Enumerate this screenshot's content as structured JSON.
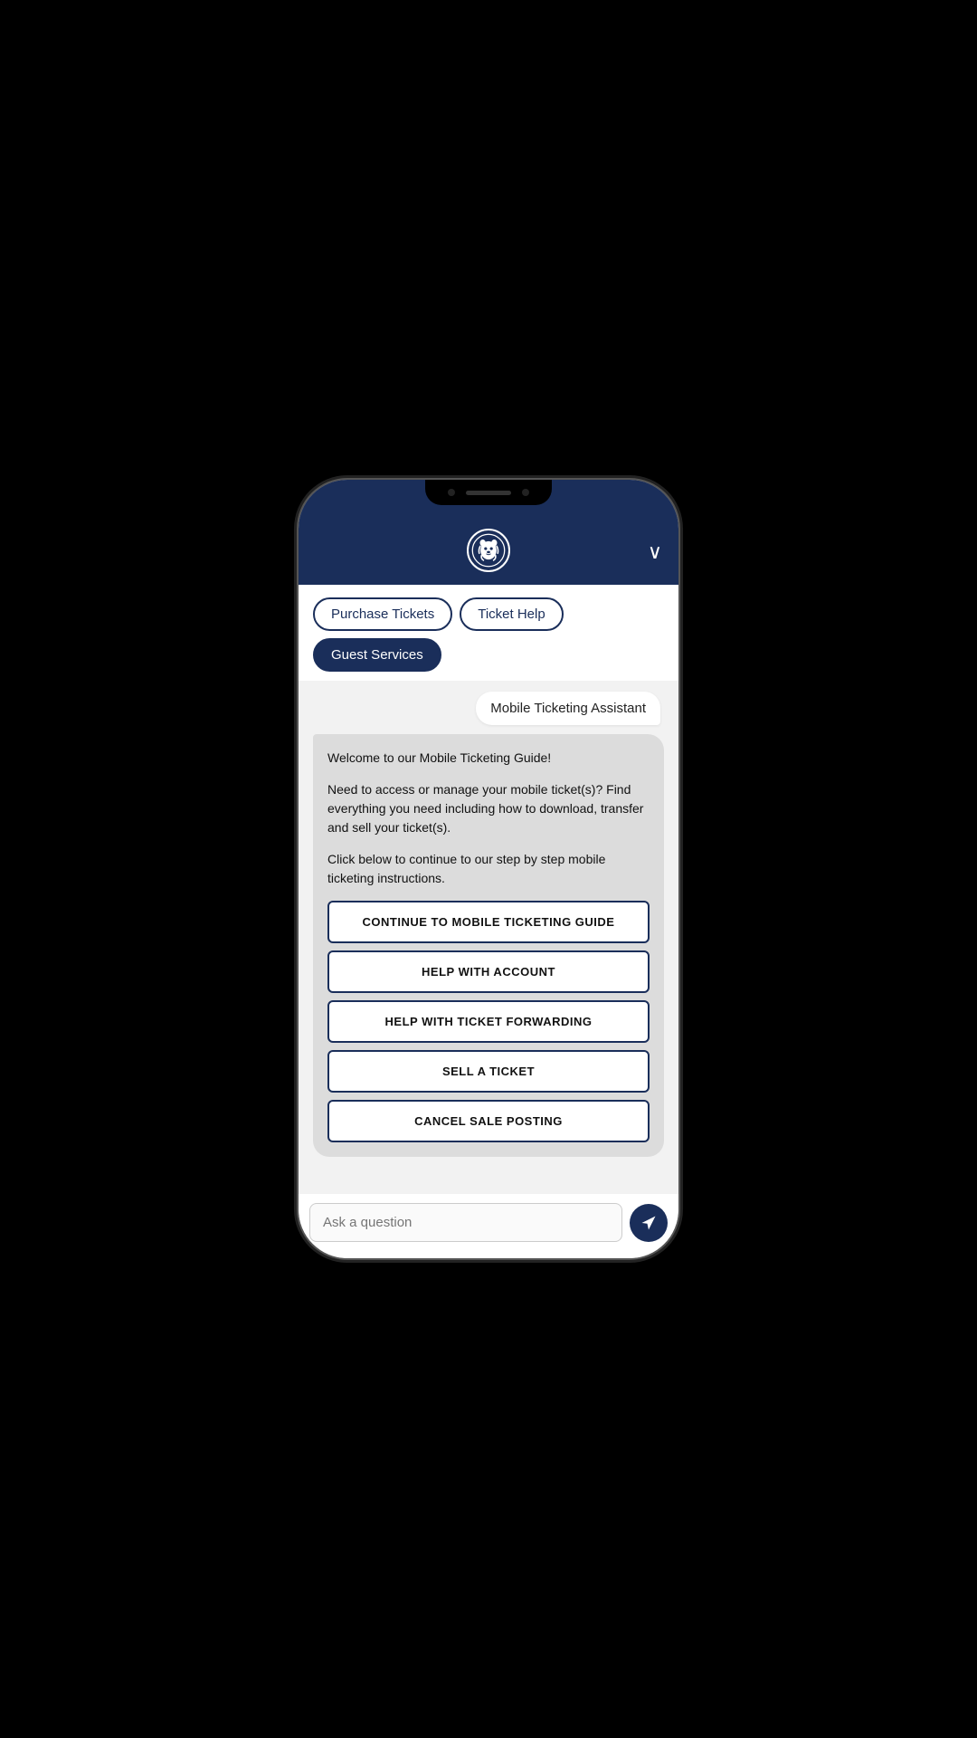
{
  "header": {
    "chevron_label": "∨",
    "logo_alt": "Penn State Nittany Lion"
  },
  "tabs": [
    {
      "id": "purchase",
      "label": "Purchase Tickets",
      "active": false
    },
    {
      "id": "ticket-help",
      "label": "Ticket Help",
      "active": false
    },
    {
      "id": "guest-services",
      "label": "Guest Services",
      "active": true
    }
  ],
  "chat": {
    "sender_name": "Mobile Ticketing Assistant",
    "bot_message_p1": "Welcome to our Mobile Ticketing Guide!",
    "bot_message_p2": "Need to access or manage your mobile ticket(s)? Find everything you need including how to download, transfer and sell your ticket(s).",
    "bot_message_p3": "Click below to continue to our step by step mobile ticketing instructions.",
    "action_buttons": [
      {
        "id": "continue-mobile",
        "label": "CONTINUE TO MOBILE TICKETING GUIDE"
      },
      {
        "id": "help-account",
        "label": "HELP WITH ACCOUNT"
      },
      {
        "id": "help-forwarding",
        "label": "HELP WITH TICKET FORWARDING"
      },
      {
        "id": "sell-ticket",
        "label": "SELL A TICKET"
      },
      {
        "id": "cancel-sale",
        "label": "CANCEL SALE POSTING"
      }
    ]
  },
  "input": {
    "placeholder": "Ask a question"
  }
}
